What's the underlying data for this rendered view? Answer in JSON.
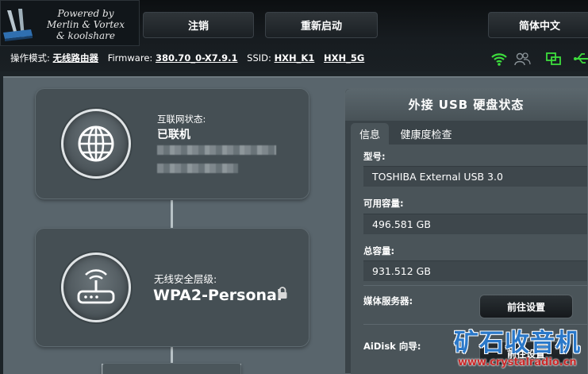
{
  "branding": {
    "line1": "Powered by",
    "line2": "Merlin & Vortex",
    "line3": "& koolshare"
  },
  "header": {
    "logout_label": "注销",
    "reboot_label": "重新启动",
    "language_label": "简体中文"
  },
  "status_bar": {
    "mode_label": "操作模式:",
    "mode_value": "无线路由器",
    "firmware_label": "Firmware:",
    "firmware_value": "380.70_0-X7.9.1",
    "ssid_label": "SSID:",
    "ssid_1": "HXH_K1",
    "ssid_2": "HXH_5G",
    "icons": [
      "wifi-icon",
      "users-icon",
      "network-icon",
      "usb-icon"
    ]
  },
  "internet": {
    "label": "互联网状态:",
    "value": "已联机"
  },
  "wireless": {
    "label": "无线安全层级:",
    "value": "WPA2-Personal"
  },
  "usb_panel": {
    "title": "外接 USB 硬盘状态",
    "tabs": [
      "信息",
      "健康度检查"
    ],
    "model_label": "型号:",
    "model_value": "TOSHIBA External USB 3.0",
    "available_label": "可用容量:",
    "available_value": "496.581 GB",
    "total_label": "总容量:",
    "total_value": "931.512 GB",
    "media_server_label": "媒体服务器:",
    "media_server_button": "前往设置",
    "aidisk_label": "AiDisk 向导:",
    "aidisk_button": "前往设置"
  },
  "watermark": {
    "text": "矿石收音机",
    "url": "www.crystalradio.cn"
  },
  "colors": {
    "accent_green": "#3ddc3d",
    "panel_bg": "#3a4348",
    "main_bg": "#59656c",
    "watermark_blue": "#2a78c9",
    "watermark_red": "#c92a2a"
  }
}
